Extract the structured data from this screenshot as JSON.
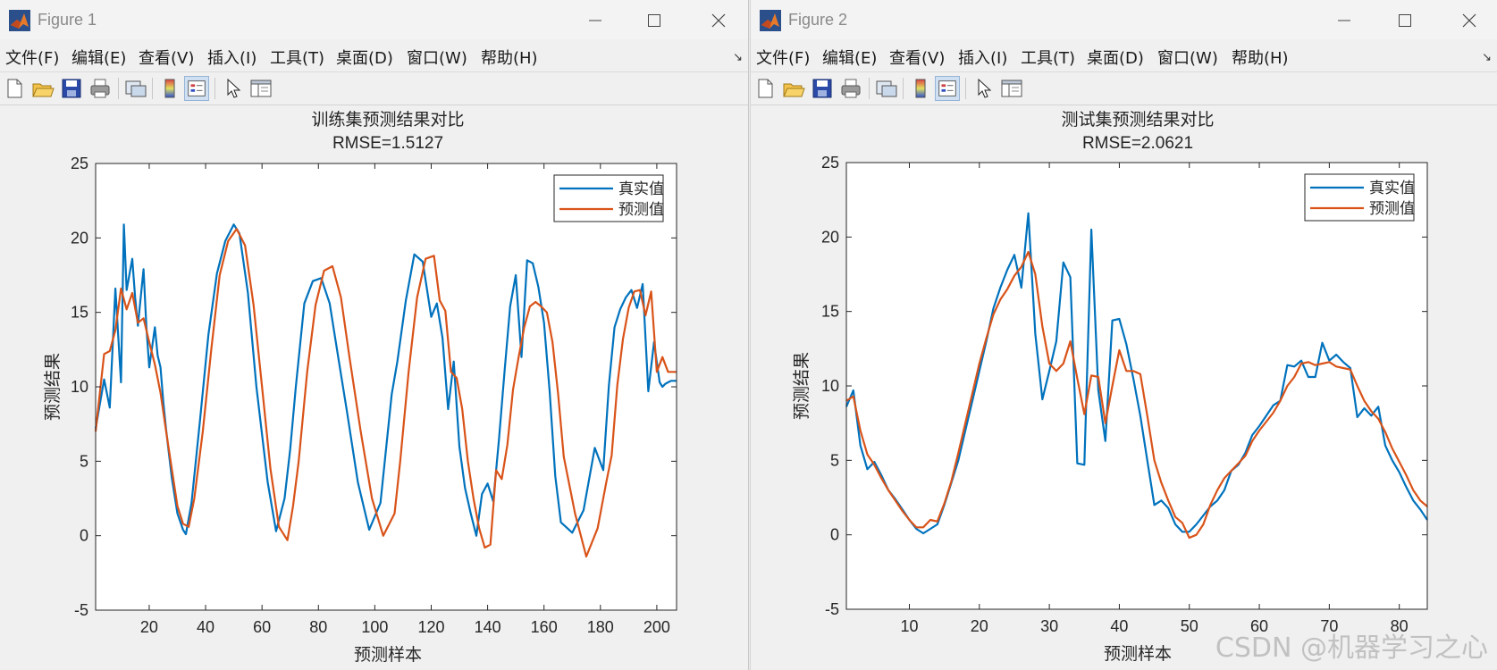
{
  "windows": [
    {
      "title": "Figure 1",
      "menus": [
        "文件(F)",
        "编辑(E)",
        "查看(V)",
        "插入(I)",
        "工具(T)",
        "桌面(D)",
        "窗口(W)",
        "帮助(H)"
      ],
      "chart_data": {
        "type": "line",
        "title": "训练集预测结果对比",
        "subtitle": "RMSE=1.5127",
        "xlabel": "预测样本",
        "ylabel": "预测结果",
        "xlim": [
          1,
          207
        ],
        "ylim": [
          -5,
          25
        ],
        "xticks": [
          20,
          40,
          60,
          80,
          100,
          120,
          140,
          160,
          180,
          200
        ],
        "yticks": [
          -5,
          0,
          5,
          10,
          15,
          20,
          25
        ],
        "legend_position": "top-right",
        "series": [
          {
            "name": "真实值",
            "color": "#0072BD",
            "x": [
              1,
              4,
              6,
              8,
              10,
              11,
              12,
              14,
              15,
              16,
              18,
              19,
              20,
              22,
              23,
              24,
              25,
              26,
              28,
              30,
              32,
              33,
              35,
              38,
              41,
              44,
              47,
              50,
              52,
              55,
              58,
              62,
              65,
              68,
              70,
              72,
              75,
              78,
              81,
              84,
              87,
              90,
              94,
              98,
              102,
              106,
              108,
              111,
              114,
              117,
              120,
              122,
              124,
              126,
              128,
              130,
              132,
              134,
              136,
              138,
              140,
              142,
              144,
              146,
              148,
              150,
              152,
              154,
              156,
              158,
              160,
              162,
              164,
              166,
              170,
              174,
              178,
              181,
              183,
              185,
              187,
              189,
              191,
              193,
              195,
              197,
              199,
              201,
              202,
              203,
              204,
              205,
              207
            ],
            "y": [
              7.2,
              10.5,
              8.6,
              16.6,
              10.3,
              20.9,
              16.5,
              18.6,
              16.0,
              14.1,
              17.9,
              14.0,
              11.3,
              14.0,
              12.1,
              11.3,
              9.0,
              7.1,
              3.9,
              1.5,
              0.4,
              0.1,
              2.2,
              7.7,
              13.5,
              17.6,
              19.8,
              20.9,
              20.3,
              16.3,
              10.0,
              3.6,
              0.3,
              2.5,
              5.8,
              10.0,
              15.6,
              17.1,
              17.3,
              15.6,
              12.0,
              8.5,
              3.6,
              0.4,
              2.2,
              9.5,
              11.7,
              15.8,
              18.9,
              18.4,
              14.7,
              15.6,
              13.3,
              8.5,
              11.7,
              6.0,
              3.2,
              1.5,
              0.0,
              2.8,
              3.5,
              2.3,
              6.4,
              11.0,
              15.4,
              17.5,
              12.0,
              18.5,
              18.3,
              16.7,
              14.3,
              9.7,
              4.0,
              0.9,
              0.2,
              1.7,
              5.9,
              4.4,
              10.1,
              14.0,
              15.2,
              16.0,
              16.5,
              15.3,
              16.9,
              9.7,
              13.0,
              10.3,
              10.0,
              10.2,
              10.3,
              10.4,
              10.4
            ]
          },
          {
            "name": "预测值",
            "color": "#D95319",
            "x": [
              1,
              4,
              6,
              8,
              10,
              12,
              14,
              16,
              18,
              20,
              22,
              24,
              26,
              28,
              30,
              32,
              34,
              36,
              39,
              42,
              45,
              48,
              51,
              54,
              57,
              60,
              63,
              66,
              69,
              71,
              73,
              76,
              79,
              82,
              85,
              88,
              91,
              95,
              99,
              103,
              107,
              109,
              112,
              115,
              118,
              121,
              123,
              125,
              127,
              129,
              131,
              133,
              135,
              137,
              139,
              141,
              143,
              145,
              147,
              149,
              151,
              153,
              155,
              157,
              159,
              161,
              163,
              165,
              167,
              171,
              175,
              179,
              182,
              184,
              186,
              188,
              190,
              192,
              194,
              196,
              198,
              200,
              202,
              204,
              206,
              207
            ],
            "y": [
              7.0,
              12.2,
              12.4,
              13.8,
              16.6,
              15.2,
              16.3,
              14.3,
              14.6,
              13.0,
              11.5,
              9.6,
              7.0,
              4.5,
              2.0,
              0.8,
              0.6,
              2.5,
              7.0,
              12.5,
              17.5,
              19.8,
              20.6,
              19.5,
              15.5,
              10.0,
              4.5,
              0.6,
              -0.3,
              2.0,
              5.0,
              11.0,
              15.5,
              17.8,
              18.1,
              16.0,
              12.0,
              7.0,
              2.5,
              0.0,
              1.5,
              5.0,
              11.0,
              16.0,
              18.6,
              18.8,
              15.8,
              15.1,
              11.0,
              10.6,
              8.5,
              5.0,
              2.5,
              0.5,
              -0.8,
              -0.6,
              4.4,
              3.8,
              6.1,
              9.8,
              12.0,
              14.0,
              15.4,
              15.7,
              15.4,
              15.0,
              13.0,
              9.5,
              5.3,
              1.5,
              -1.4,
              0.5,
              3.5,
              5.4,
              10.1,
              13.2,
              15.3,
              16.4,
              16.5,
              14.8,
              16.4,
              11.0,
              12.0,
              11.0,
              11.0,
              11.0
            ]
          }
        ]
      }
    },
    {
      "title": "Figure 2",
      "menus": [
        "文件(F)",
        "编辑(E)",
        "查看(V)",
        "插入(I)",
        "工具(T)",
        "桌面(D)",
        "窗口(W)",
        "帮助(H)"
      ],
      "chart_data": {
        "type": "line",
        "title": "测试集预测结果对比",
        "subtitle": "RMSE=2.0621",
        "xlabel": "预测样本",
        "ylabel": "预测结果",
        "xlim": [
          1,
          84
        ],
        "ylim": [
          -5,
          25
        ],
        "xticks": [
          10,
          20,
          30,
          40,
          50,
          60,
          70,
          80
        ],
        "yticks": [
          -5,
          0,
          5,
          10,
          15,
          20,
          25
        ],
        "legend_position": "top-right",
        "series": [
          {
            "name": "真实值",
            "color": "#0072BD",
            "x": [
              1,
              2,
              3,
              4,
              5,
              6,
              7,
              8,
              9,
              10,
              11,
              12,
              13,
              14,
              15,
              16,
              17,
              18,
              19,
              20,
              21,
              22,
              23,
              24,
              25,
              26,
              27,
              28,
              29,
              30,
              31,
              32,
              33,
              34,
              35,
              36,
              37,
              38,
              39,
              40,
              41,
              42,
              43,
              44,
              45,
              46,
              47,
              48,
              49,
              50,
              51,
              52,
              53,
              54,
              55,
              56,
              57,
              58,
              59,
              60,
              61,
              62,
              63,
              64,
              65,
              66,
              67,
              68,
              69,
              70,
              71,
              72,
              73,
              74,
              75,
              76,
              77,
              78,
              79,
              80,
              81,
              82,
              83,
              84
            ],
            "y": [
              8.6,
              9.7,
              6.0,
              4.4,
              4.9,
              4.0,
              3.0,
              2.4,
              1.7,
              1.0,
              0.4,
              0.1,
              0.4,
              0.7,
              2.0,
              3.5,
              5.0,
              7.0,
              9.0,
              11.0,
              13.0,
              15.2,
              16.6,
              17.8,
              18.8,
              16.6,
              21.6,
              13.5,
              9.1,
              11.0,
              13.0,
              18.3,
              17.3,
              4.8,
              4.7,
              20.5,
              9.7,
              6.3,
              14.4,
              14.5,
              12.8,
              10.5,
              8.0,
              5.0,
              2.0,
              2.3,
              1.8,
              0.7,
              0.2,
              0.2,
              0.7,
              1.3,
              1.9,
              2.3,
              3.0,
              4.3,
              4.7,
              5.5,
              6.7,
              7.3,
              8.0,
              8.7,
              9.0,
              11.4,
              11.3,
              11.7,
              10.6,
              10.6,
              12.9,
              11.7,
              12.1,
              11.6,
              11.2,
              7.9,
              8.5,
              8.0,
              8.6,
              6.0,
              5.0,
              4.2,
              3.2,
              2.3,
              1.7,
              1.0
            ]
          },
          {
            "name": "预测值",
            "color": "#D95319",
            "x": [
              1,
              2,
              3,
              4,
              5,
              6,
              7,
              8,
              9,
              10,
              11,
              12,
              13,
              14,
              15,
              16,
              17,
              18,
              19,
              20,
              21,
              22,
              23,
              24,
              25,
              26,
              27,
              28,
              29,
              30,
              31,
              32,
              33,
              34,
              35,
              36,
              37,
              38,
              39,
              40,
              41,
              42,
              43,
              44,
              45,
              46,
              47,
              48,
              49,
              50,
              51,
              52,
              53,
              54,
              55,
              56,
              57,
              58,
              59,
              60,
              61,
              62,
              63,
              64,
              65,
              66,
              67,
              68,
              69,
              70,
              71,
              72,
              73,
              74,
              75,
              76,
              77,
              78,
              79,
              80,
              81,
              82,
              83,
              84
            ],
            "y": [
              9.0,
              9.3,
              7.0,
              5.4,
              4.7,
              3.8,
              3.0,
              2.3,
              1.6,
              1.0,
              0.5,
              0.5,
              1.0,
              0.9,
              2.1,
              3.6,
              5.5,
              7.5,
              9.5,
              11.5,
              13.2,
              14.8,
              15.8,
              16.5,
              17.4,
              18.0,
              19.0,
              17.5,
              14.0,
              11.5,
              11.0,
              11.5,
              13.0,
              10.5,
              8.1,
              10.7,
              10.6,
              7.5,
              10.0,
              12.4,
              11.0,
              11.0,
              10.8,
              8.0,
              5.0,
              3.5,
              2.3,
              1.2,
              0.8,
              -0.2,
              0.0,
              0.7,
              2.0,
              3.0,
              3.8,
              4.3,
              4.8,
              5.3,
              6.3,
              7.0,
              7.6,
              8.2,
              9.0,
              10.0,
              10.6,
              11.5,
              11.6,
              11.4,
              11.5,
              11.6,
              11.3,
              11.2,
              11.1,
              10.0,
              9.0,
              8.3,
              7.8,
              6.9,
              5.8,
              4.9,
              4.0,
              3.0,
              2.3,
              1.9
            ]
          }
        ]
      }
    }
  ],
  "watermark": "CSDN @机器学习之心"
}
